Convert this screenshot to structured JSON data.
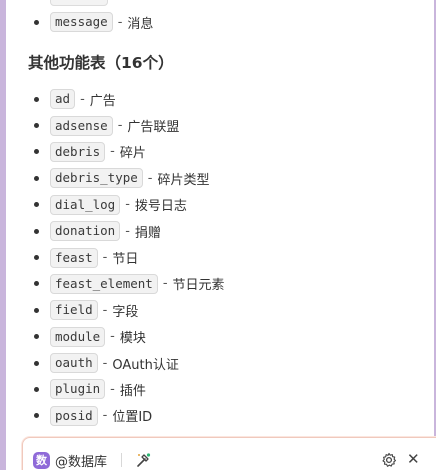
{
  "first_list": {
    "items": [
      {
        "code": "message",
        "desc": "消息"
      }
    ]
  },
  "section": {
    "title": "其他功能表（16个）"
  },
  "second_list": {
    "items": [
      {
        "code": "ad",
        "desc": "广告"
      },
      {
        "code": "adsense",
        "desc": "广告联盟"
      },
      {
        "code": "debris",
        "desc": "碎片"
      },
      {
        "code": "debris_type",
        "desc": "碎片类型"
      },
      {
        "code": "dial_log",
        "desc": "拨号日志"
      },
      {
        "code": "donation",
        "desc": "捐赠"
      },
      {
        "code": "feast",
        "desc": "节日"
      },
      {
        "code": "feast_element",
        "desc": "节日元素"
      },
      {
        "code": "field",
        "desc": "字段"
      },
      {
        "code": "module",
        "desc": "模块"
      },
      {
        "code": "oauth",
        "desc": "OAuth认证"
      },
      {
        "code": "plugin",
        "desc": "插件"
      },
      {
        "code": "posid",
        "desc": "位置ID"
      }
    ]
  },
  "separator": "-",
  "input_bar": {
    "db_icon_text": "数",
    "db_label": "@数据库",
    "icons": {
      "tool": "tool-icon",
      "settings": "gear-icon",
      "close": "close-icon"
    },
    "close_glyph": "✕"
  },
  "colors": {
    "accent_left": "#c9b5dc",
    "db_icon_bg": "#8f6ad8",
    "input_border": "#f0c9bd"
  }
}
